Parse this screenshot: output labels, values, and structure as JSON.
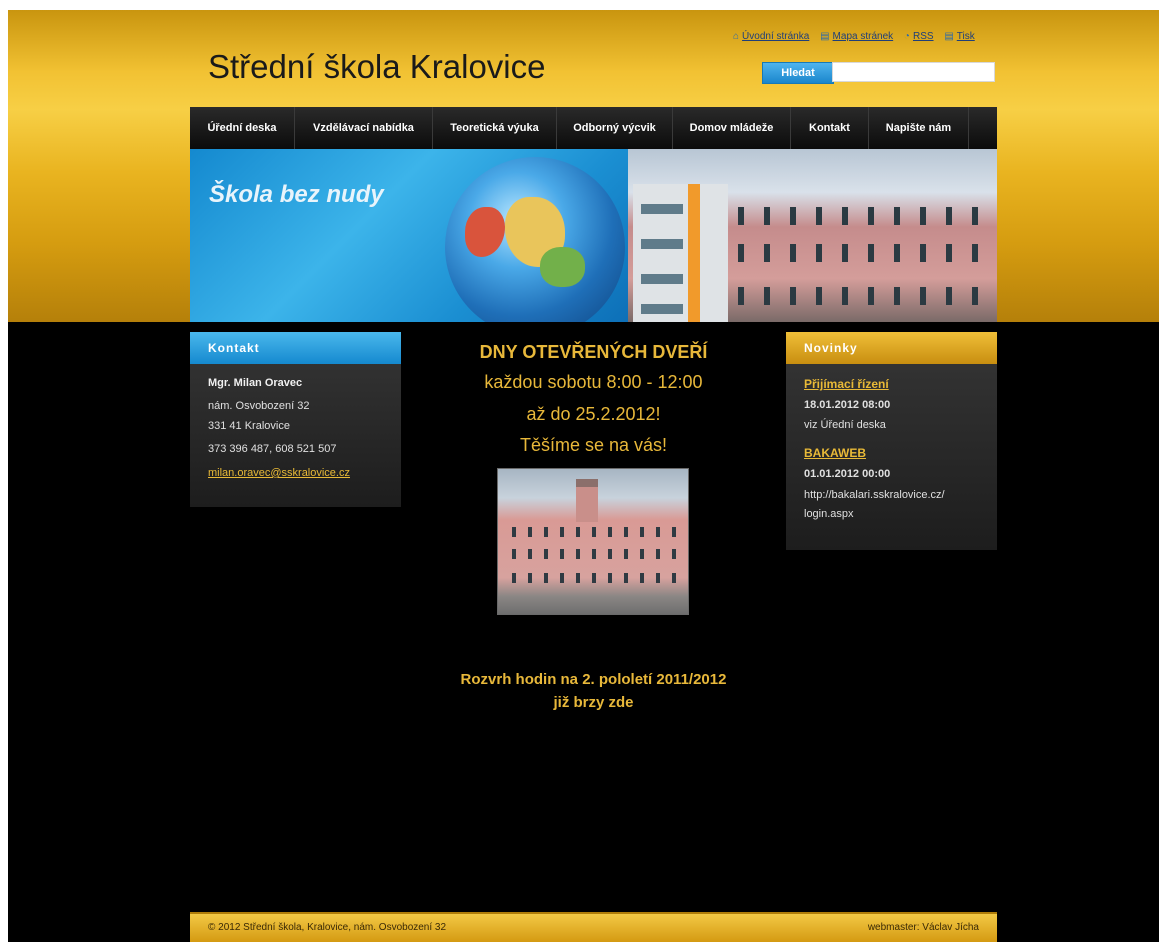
{
  "header": {
    "site_title": "Střední škola Kralovice",
    "toplinks": [
      {
        "label": "Úvodní stránka",
        "icon": "home-icon"
      },
      {
        "label": "Mapa stránek",
        "icon": "sitemap-icon"
      },
      {
        "label": "RSS",
        "icon": "rss-icon"
      },
      {
        "label": "Tisk",
        "icon": "print-icon"
      }
    ],
    "search": {
      "button_label": "Hledat",
      "value": ""
    }
  },
  "nav": {
    "items": [
      "Úřední deska",
      "Vzdělávací nabídka",
      "Teoretická výuka",
      "Odborný výcvik",
      "Domov mládeže",
      "Kontakt",
      "Napište nám"
    ]
  },
  "banner": {
    "slogan": "Škola bez nudy"
  },
  "contact_box": {
    "heading": "Kontakt",
    "name": "Mgr. Milan Oravec",
    "street": "nám. Osvobození 32",
    "city": "331 41 Kralovice",
    "phones": "373 396 487, 608 521 507",
    "email": "milan.oravec@sskralovice.cz"
  },
  "main": {
    "line1": "DNY OTEVŘENÝCH DVEŘÍ",
    "line2": "každou sobotu 8:00 - 12:00",
    "line3": "až do 25.2.2012!",
    "line4": "Těšíme se na vás!",
    "schedule1": "Rozvrh hodin na 2. pololetí 2011/2012",
    "schedule2": "již brzy zde"
  },
  "news_box": {
    "heading": "Novinky",
    "items": [
      {
        "title": "Přijímací řízení",
        "date": "18.01.2012 08:00",
        "text": "viz Úřední deska"
      },
      {
        "title": "BAKAWEB",
        "date": "01.01.2012 00:00",
        "text1": "http://bakalari.sskralovice.cz/",
        "text2": "login.aspx"
      }
    ]
  },
  "footer": {
    "left": "© 2012 Střední škola, Kralovice, nám. Osvobození 32",
    "right": "webmaster: Václav Jícha"
  },
  "colors": {
    "gold": "#e8b83a",
    "blue": "#1589cf",
    "background": "#000000"
  }
}
